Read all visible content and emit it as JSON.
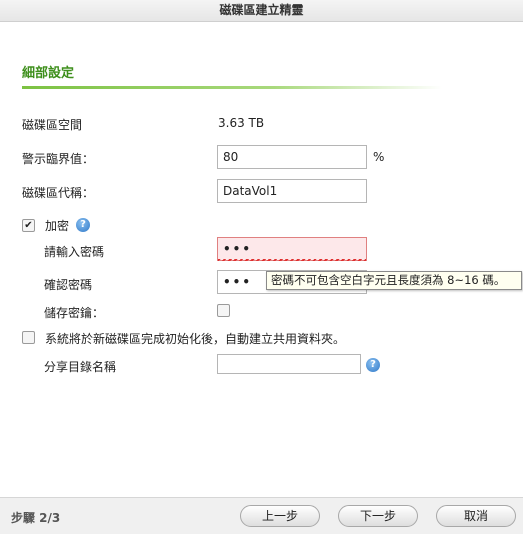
{
  "window": {
    "title": "磁碟區建立精靈"
  },
  "section": {
    "title": "細部設定"
  },
  "fields": {
    "volume_space": {
      "label": "磁碟區空間",
      "value": "3.63 TB"
    },
    "alert_threshold": {
      "label": "警示臨界值：",
      "value": "80",
      "unit": "%"
    },
    "volume_alias": {
      "label": "磁碟區代稱：",
      "value": "DataVol1"
    },
    "encryption": {
      "label": "加密",
      "checked": true,
      "help_icon": "help-icon",
      "password": {
        "label": "請輸入密碼",
        "value": "•••"
      },
      "confirm_password": {
        "label": "確認密碼",
        "value": "•••"
      },
      "save_key": {
        "label": "儲存密鑰：",
        "checked": false
      }
    },
    "auto_share": {
      "label": "系統將於新磁碟區完成初始化後，自動建立共用資料夾。",
      "checked": false,
      "folder_name": {
        "label": "分享目錄名稱",
        "value": ""
      },
      "help_icon": "help-icon"
    }
  },
  "tooltip": {
    "text": "密碼不可包含空白字元且長度須為 8~16 碼。"
  },
  "footer": {
    "step": "步驟 2/3",
    "prev_label": "上一步",
    "next_label": "下一步",
    "cancel_label": "取消"
  }
}
